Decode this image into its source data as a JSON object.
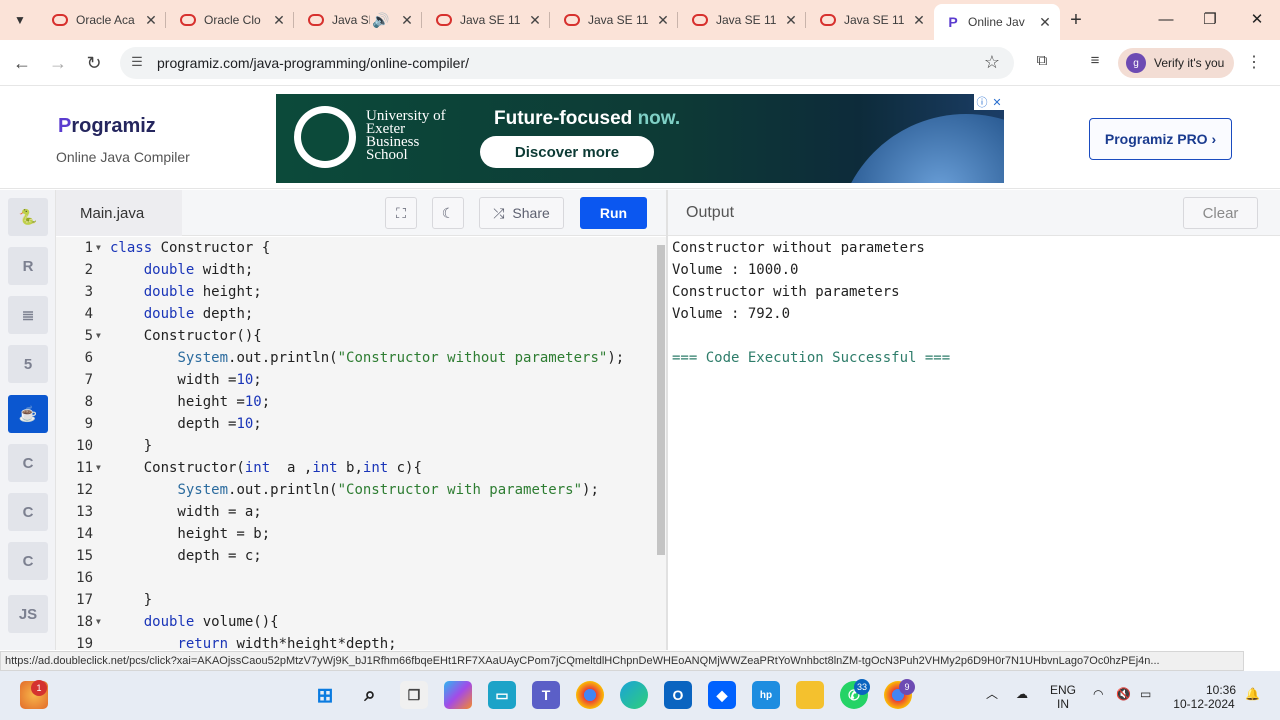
{
  "browser": {
    "tabs": [
      {
        "label": "Oracle Aca",
        "favicon": "oracle-icon"
      },
      {
        "label": "Oracle Clo",
        "favicon": "oracle-icon"
      },
      {
        "label": "Java SE",
        "favicon": "oracle-icon"
      },
      {
        "label": "Java SE 11",
        "favicon": "oracle-icon"
      },
      {
        "label": "Java SE 11",
        "favicon": "oracle-icon"
      },
      {
        "label": "Java SE 11",
        "favicon": "oracle-icon"
      },
      {
        "label": "Java SE 11",
        "favicon": "oracle-icon"
      },
      {
        "label": "Online Jav",
        "favicon": "programiz-icon",
        "active": true
      }
    ],
    "url": "programiz.com/java-programming/online-compiler/",
    "verify_label": "Verify it's you",
    "avatar_letter": "g"
  },
  "header": {
    "logo": "rogramiz",
    "logo_p": "P",
    "subtitle": "Online Java Compiler",
    "pro_button": "Programiz PRO ›"
  },
  "ad": {
    "university": "University of Exeter Business School",
    "headline": "Future-focused",
    "headline_accent": "now.",
    "cta": "Discover more"
  },
  "editor": {
    "filename": "Main.java",
    "share_label": "Share",
    "run_label": "Run",
    "lines": [
      "1",
      "2",
      "3",
      "4",
      "5",
      "6",
      "7",
      "8",
      "9",
      "10",
      "11",
      "12",
      "13",
      "14",
      "15",
      "16",
      "17",
      "18",
      "19"
    ]
  },
  "output": {
    "title": "Output",
    "clear_label": "Clear",
    "lines": [
      "Constructor without parameters",
      "Volume : 1000.0",
      "Constructor with parameters",
      "Volume : 792.0",
      "",
      "=== Code Execution Successful ==="
    ]
  },
  "status_url": "https://ad.doubleclick.net/pcs/click?xai=AKAOjssCaou52pMtzV7yWj9K_bJ1Rfhm66fbqeEHt1RF7XAaUAyCPom7jCQmeltdlHChpnDeWHEoANQMjWWZeaPRtYoWnhbct8lnZM-tgOcN3Puh2VHMy2p6D9H0r7N1UHbvnLago7Oc0hzPEj4n...",
  "taskbar": {
    "lang_top": "ENG",
    "lang_bottom": "IN",
    "time": "10:36",
    "date": "10-12-2024",
    "whatsapp_badge": "33",
    "chrome_badge": "9",
    "weather_badge": "1"
  },
  "colors": {
    "accent": "#0b57f0",
    "keyword": "#1a35b8",
    "string": "#2e7d32",
    "success": "#2e7d6a"
  }
}
